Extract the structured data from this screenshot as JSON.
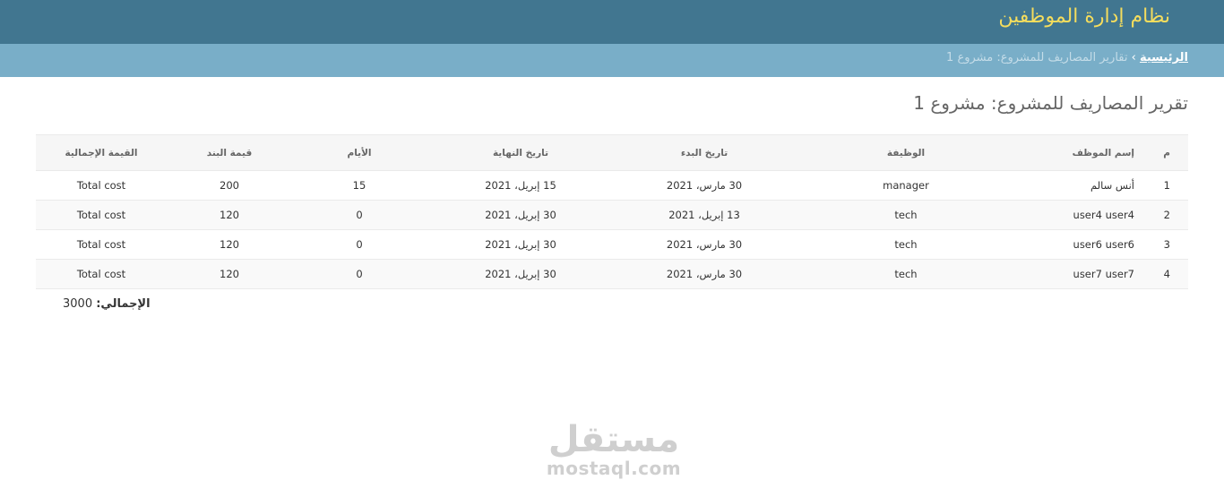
{
  "header": {
    "brand": "نظام إدارة الموظفين"
  },
  "breadcrumbs": {
    "home": "الرئيسية",
    "separator": "›",
    "current": "تقارير المصاريف للمشروع: مشروع 1"
  },
  "page_title": "تقرير المصاريف للمشروع: مشروع 1",
  "table": {
    "headers": [
      "م",
      "إسم الموظف",
      "الوظيفة",
      "تاريخ البدء",
      "تاريخ النهاية",
      "الأيام",
      "قيمة البند",
      "القيمة الإجمالية"
    ],
    "rows": [
      [
        "1",
        "أنس سالم",
        "manager",
        "30 مارس، 2021",
        "15 إبريل، 2021",
        "15",
        "200",
        "Total cost"
      ],
      [
        "2",
        "user4 user4",
        "tech",
        "13 إبريل، 2021",
        "30 إبريل، 2021",
        "0",
        "120",
        "Total cost"
      ],
      [
        "3",
        "user6 user6",
        "tech",
        "30 مارس، 2021",
        "30 إبريل، 2021",
        "0",
        "120",
        "Total cost"
      ],
      [
        "4",
        "user7 user7",
        "tech",
        "30 مارس، 2021",
        "30 إبريل، 2021",
        "0",
        "120",
        "Total cost"
      ]
    ]
  },
  "summary": {
    "label": "الإجمالي:",
    "value": "3000"
  },
  "watermark": {
    "arabic": "مستقل",
    "latin": "mostaql.com"
  },
  "colors": {
    "header_bg": "#417690",
    "breadcrumb_bg": "#79aec8",
    "brand_text": "#f5dd5d"
  }
}
